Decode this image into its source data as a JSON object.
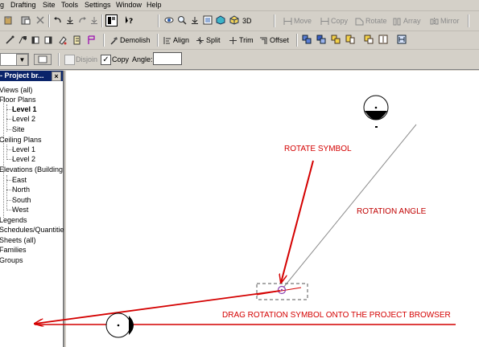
{
  "menu": {
    "items": [
      "g",
      "Drafting",
      "Site",
      "Tools",
      "Settings",
      "Window",
      "Help"
    ]
  },
  "toolbar1": {
    "view3d_label": "3D",
    "move_label": "Move",
    "copy_label": "Copy",
    "rotate_label": "Rotate",
    "array_label": "Array",
    "mirror_label": "Mirror"
  },
  "toolbar2": {
    "demolish_label": "Demolish",
    "align_label": "Align",
    "split_label": "Split",
    "trim_label": "Trim",
    "offset_label": "Offset"
  },
  "options": {
    "disjoin_label": "Disjoin",
    "disjoin_checked": false,
    "copy_label": "Copy",
    "copy_checked": true,
    "angle_label": "Angle:",
    "angle_value": ""
  },
  "project_browser": {
    "title": "- Project br...",
    "close": "×",
    "items": [
      {
        "label": "Views (all)"
      },
      {
        "label": "Floor Plans"
      },
      {
        "label": "Level 1",
        "bold": true
      },
      {
        "label": "Level 2"
      },
      {
        "label": "Site"
      },
      {
        "label": "Ceiling Plans"
      },
      {
        "label": "Level 1"
      },
      {
        "label": "Level 2"
      },
      {
        "label": "Elevations (Building"
      },
      {
        "label": "East"
      },
      {
        "label": "North"
      },
      {
        "label": "South"
      },
      {
        "label": "West"
      },
      {
        "label": "Legends"
      },
      {
        "label": "Schedules/Quantitie"
      },
      {
        "label": "Sheets (all)"
      },
      {
        "label": "Families"
      },
      {
        "label": "Groups"
      }
    ]
  },
  "canvas": {
    "rotate_symbol_note": "ROTATE SYMBOL",
    "rotation_angle_note": "ROTATION ANGLE",
    "drag_note": "DRAG ROTATION SYMBOL ONTO THE PROJECT BROWSER"
  },
  "colors": {
    "annotation": "#d40000",
    "browser_title_bg": "#0a246a",
    "chrome": "#d4d0c8"
  }
}
